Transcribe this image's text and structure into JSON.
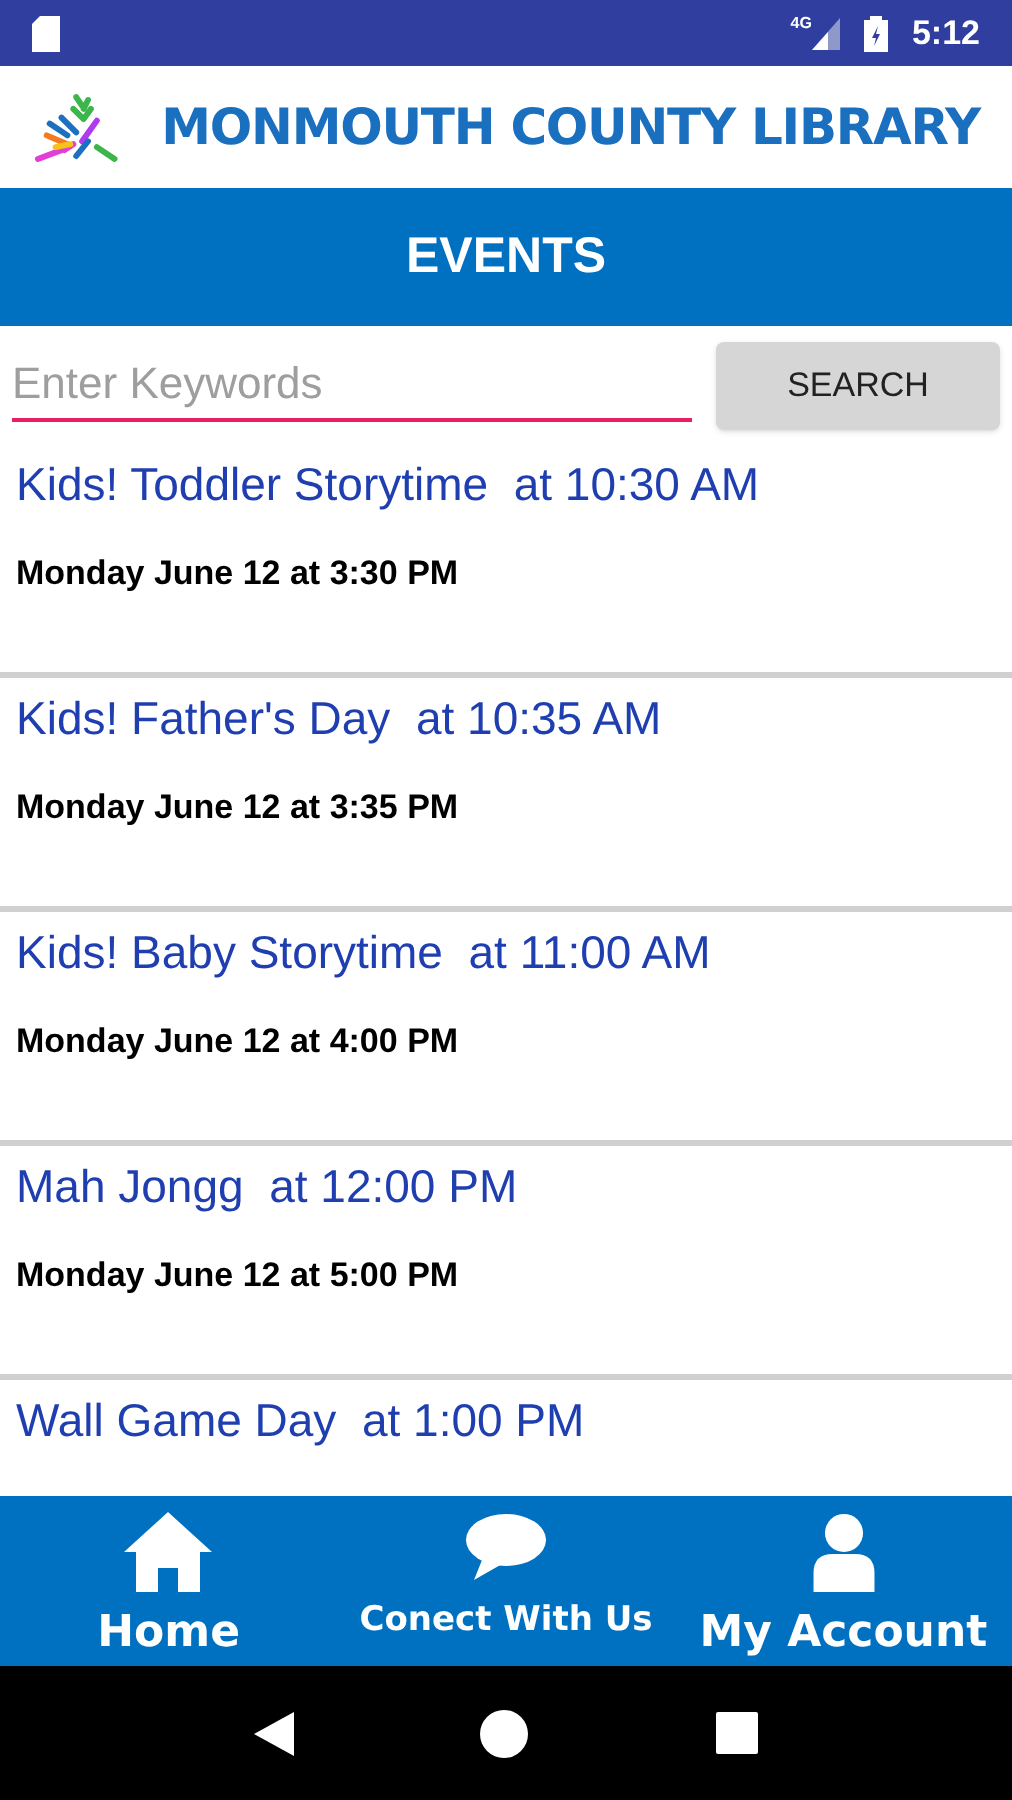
{
  "status_bar": {
    "network": "4G",
    "time": "5:12"
  },
  "header": {
    "title": "MONMOUTH COUNTY LIBRARY"
  },
  "page_title": "EVENTS",
  "search": {
    "placeholder": "Enter Keywords",
    "button": "SEARCH"
  },
  "events": [
    {
      "title": "Kids! Toddler Storytime  at 10:30 AM",
      "date": "Monday June 12 at 3:30 PM"
    },
    {
      "title": "Kids! Father's Day  at 10:35 AM",
      "date": "Monday June 12 at 3:35 PM"
    },
    {
      "title": "Kids! Baby Storytime  at 11:00 AM",
      "date": "Monday June 12 at 4:00 PM"
    },
    {
      "title": "Mah Jongg  at 12:00 PM",
      "date": "Monday June 12 at 5:00 PM"
    },
    {
      "title": "Wall Game Day  at 1:00 PM"
    }
  ],
  "bottom_nav": [
    {
      "kind": "home",
      "label": "Home"
    },
    {
      "kind": "chat",
      "label": "Conect With Us"
    },
    {
      "kind": "account",
      "label": "My Account"
    }
  ]
}
